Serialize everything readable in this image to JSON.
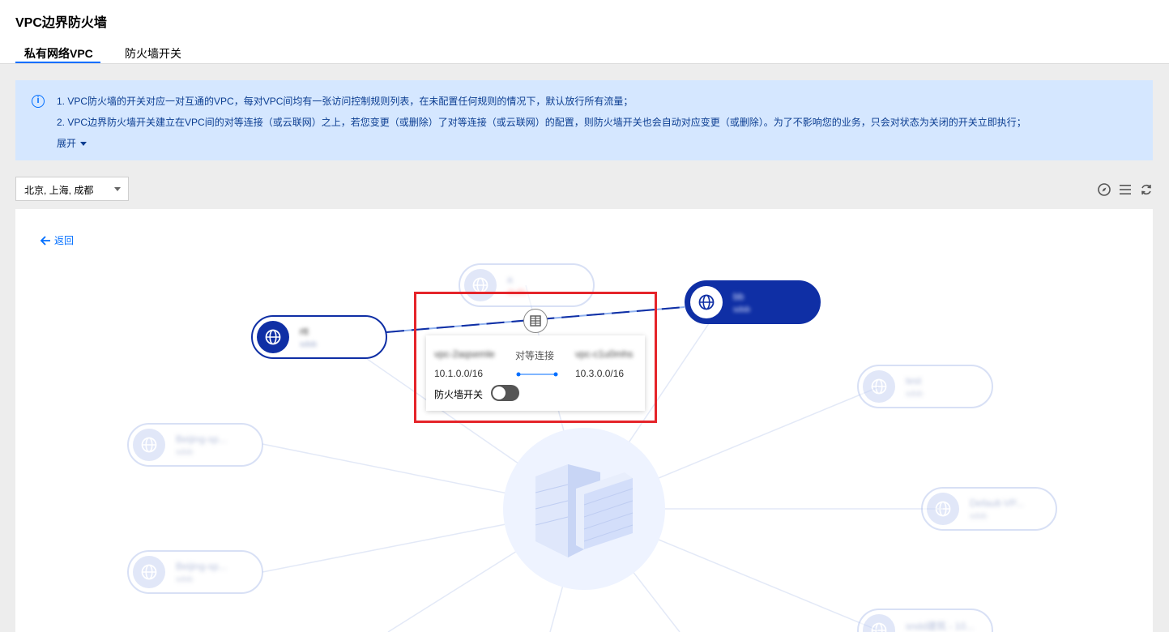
{
  "page": {
    "title": "VPC边界防火墙"
  },
  "tabs": [
    {
      "label": "私有网络VPC",
      "active": true
    },
    {
      "label": "防火墙开关",
      "active": false
    }
  ],
  "notice": {
    "line1": "1. VPC防火墙的开关对应一对互通的VPC，每对VPC间均有一张访问控制规则列表，在未配置任何规则的情况下，默认放行所有流量；",
    "line2": "2. VPC边界防火墙开关建立在VPC间的对等连接（或云联网）之上，若您变更（或删除）了对等连接（或云联网）的配置，则防火墙开关也会自动对应变更（或删除）。为了不影响您的业务，只会对状态为关闭的开关立即执行；",
    "expand": "展开"
  },
  "region_select": {
    "value": "北京, 上海, 成都"
  },
  "toolbar": {
    "icons": [
      "compass-icon",
      "list-icon",
      "refresh-icon"
    ]
  },
  "canvas": {
    "back_label": "返回",
    "nodes": [
      {
        "name": "rtt",
        "sub": "sdsb",
        "state": "selected-outline"
      },
      {
        "name": "bb",
        "sub": "sdsb",
        "state": "selected-fill"
      },
      {
        "name": "a",
        "sub": "dsdfs",
        "state": "faded"
      },
      {
        "name": "test",
        "sub": "sdsb",
        "state": "faded"
      },
      {
        "name": "Beijing-sp...",
        "sub": "sdsb",
        "state": "faded"
      },
      {
        "name": "Beijing-sp...",
        "sub": "sdsb",
        "state": "faded"
      },
      {
        "name": "Default-VP...",
        "sub": "sdsb",
        "state": "faded"
      },
      {
        "name": "sndd建筑 - 10...",
        "sub": "sdsb",
        "state": "faded"
      }
    ],
    "popover": {
      "vpc_left": "vpc-2aqsemle",
      "peer_label": "对等连接",
      "vpc_right": "vpc-c1u0mhs",
      "cidr_left": "10.1.0.0/16",
      "cidr_right": "10.3.0.0/16",
      "switch_label": "防火墙开关",
      "switch_on": false
    }
  },
  "colors": {
    "accent": "#006eff",
    "selected_node": "#0f2fa5",
    "highlight": "#e5242a",
    "notice_bg": "#d5e7ff"
  }
}
